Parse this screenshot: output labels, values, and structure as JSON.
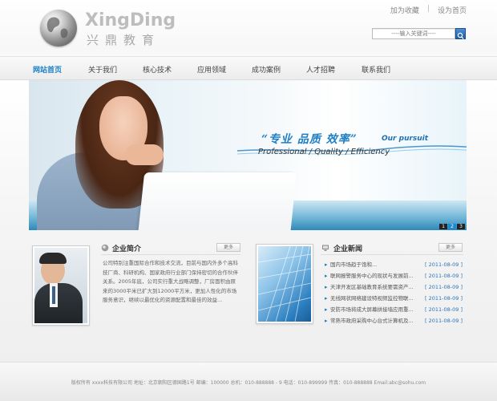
{
  "header": {
    "logo_en": "XingDing",
    "logo_cn": "兴鼎教育",
    "links": [
      "加为收藏",
      "设为首页"
    ],
    "link_sep": "|",
    "search_placeholder": "----输入关键词----"
  },
  "nav": {
    "items": [
      "网站首页",
      "关于我们",
      "核心技术",
      "应用领域",
      "成功案例",
      "人才招聘",
      "联系我们"
    ]
  },
  "banner": {
    "slogan_cn": "“专业  品质  效率”",
    "slogan_pursuit": "Our pursuit",
    "slogan_en": "Professional / Quality / Efficiency",
    "pages": [
      "1",
      "2",
      "3"
    ]
  },
  "intro": {
    "title": "企业简介",
    "more": "更多",
    "text": "公司特别注重国际合作和技术交流，目前与国内外多个高科技厂商、科研机构、国家政府行业部门保持密切的合作伙伴关系。2005年底，公司实行重大战略调整，厂房面积由原来的3000平米已扩大到12000平方米，更加人性化的市场服务意识，继续以最优化的资源配置和最佳的效益..."
  },
  "news": {
    "title": "企业新闻",
    "more": "更多",
    "items": [
      {
        "title": "国内市场趋于饱和...",
        "date": "[ 2011-08-09 ]"
      },
      {
        "title": "联网报警服务中心的现状与发展前...",
        "date": "[ 2011-08-09 ]"
      },
      {
        "title": "天津开发区基础教育系统要需资产...",
        "date": "[ 2011-08-09 ]"
      },
      {
        "title": "无线网状网络建设特视频监控物联...",
        "date": "[ 2011-08-09 ]"
      },
      {
        "title": "安防市场将成大屏幕拼接墙应用重...",
        "date": "[ 2011-08-09 ]"
      },
      {
        "title": "常熟市政府采购中心台式计算机及...",
        "date": "[ 2011-08-09 ]"
      }
    ]
  },
  "footer": {
    "text": "版权所有 xxxx科技有限公司 地址：北京朝阳区德国路1号 邮编：100000 总机：010-888888 - 9 电话：010-899999 传真：010-888888 Email:abc@sohu.com"
  }
}
